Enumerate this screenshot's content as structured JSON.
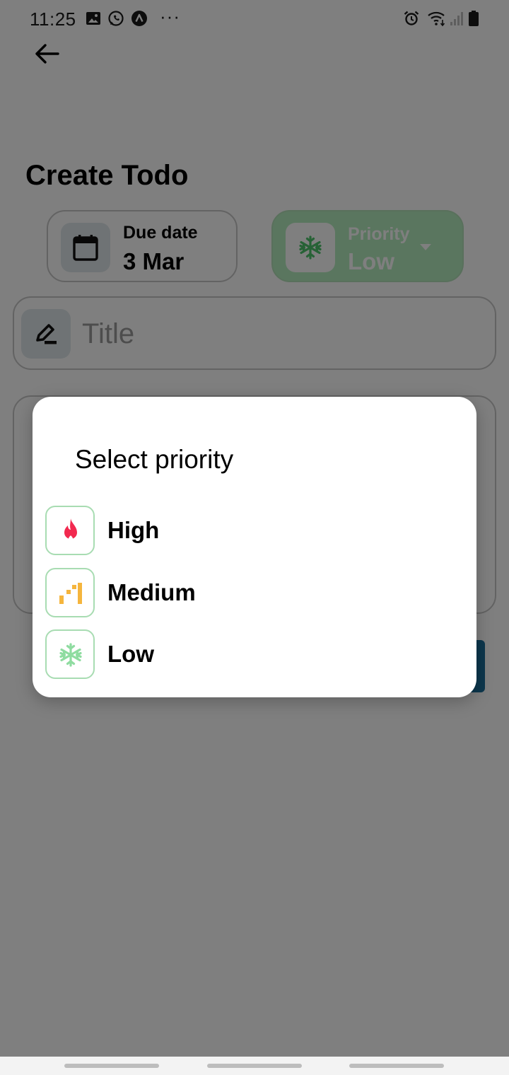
{
  "status_bar": {
    "time": "11:25",
    "overflow": "···",
    "left_icons": [
      "gallery-icon",
      "whatsapp-icon",
      "vpn-icon"
    ],
    "right_icons": [
      "alarm-icon",
      "wifi-icon",
      "signal-icon",
      "battery-icon"
    ]
  },
  "header": {
    "back_icon": "arrow-left-icon"
  },
  "page": {
    "title": "Create Todo"
  },
  "due_date": {
    "label": "Due date",
    "value": "3 Mar",
    "icon": "calendar-icon"
  },
  "priority": {
    "label": "Priority",
    "value": "Low",
    "icon": "snowflake-icon",
    "accent": "#b5ecbf"
  },
  "title_field": {
    "placeholder": "Title",
    "value": "",
    "icon": "pencil-icon"
  },
  "dialog": {
    "title": "Select priority",
    "options": [
      {
        "label": "High",
        "icon": "fire-icon",
        "color": "#f2294f"
      },
      {
        "label": "Medium",
        "icon": "bars-icon",
        "color": "#f5b53d"
      },
      {
        "label": "Low",
        "icon": "snowflake-icon",
        "color": "#8fdca0"
      }
    ]
  },
  "colors": {
    "scrim": "rgba(0,0,0,0.5)",
    "save_button": "#1b6f9a",
    "option_border": "#a8dcb2"
  }
}
